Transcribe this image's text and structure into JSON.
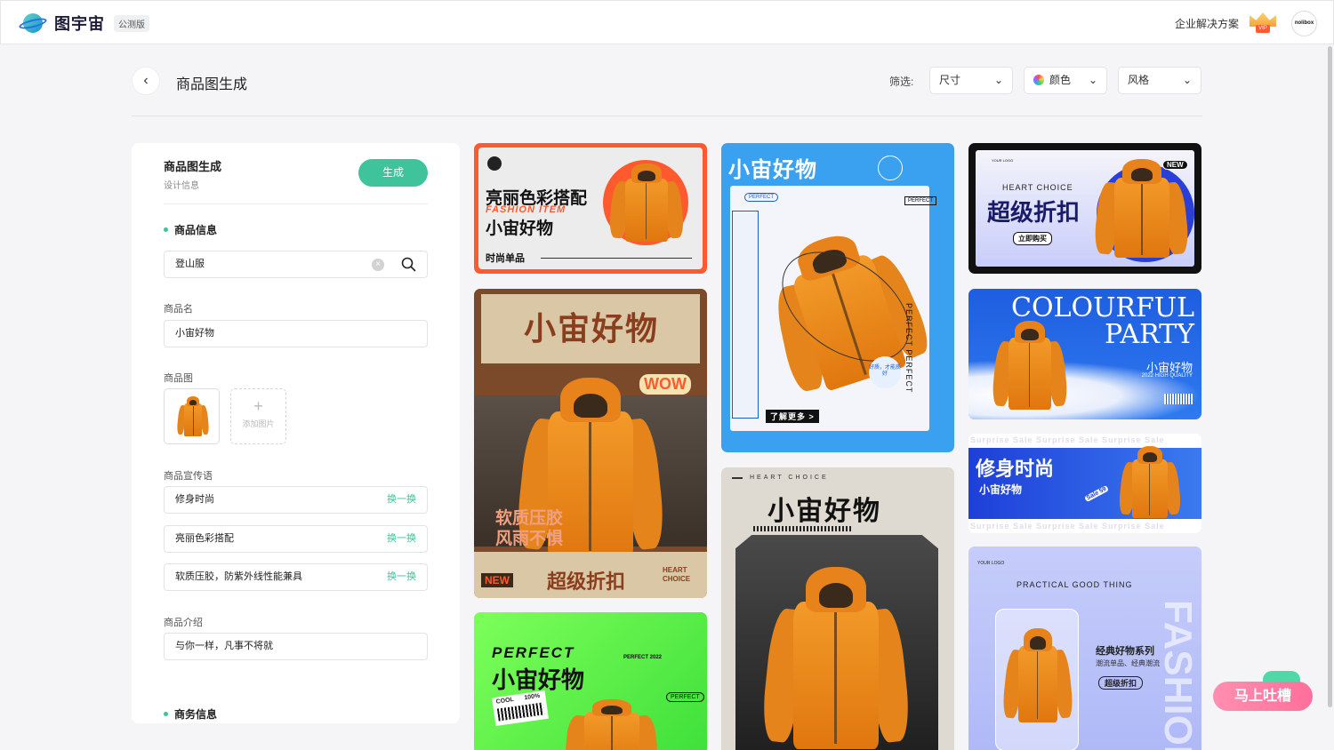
{
  "app": {
    "brand": "图宇宙",
    "badge": "公测版",
    "enterprise": "企业解决方案",
    "vip": "VIP",
    "avatar": "nolibox"
  },
  "header": {
    "title": "商品图生成",
    "filter_label": "筛选:",
    "filters": [
      "尺寸",
      "颜色",
      "风格"
    ]
  },
  "panel": {
    "title": "商品图生成",
    "subtitle": "设计信息",
    "generate": "生成",
    "section_product": "商品信息",
    "search_value": "登山服",
    "name_label": "商品名",
    "name_value": "小宙好物",
    "image_label": "商品图",
    "add_image": "添加图片",
    "slogan_label": "商品宣传语",
    "slogans": [
      "修身时尚",
      "亮丽色彩搭配",
      "软质压胶，防紫外线性能兼具"
    ],
    "swap": "换一换",
    "intro_label": "商品介绍",
    "intro_value": "与你一样，凡事不将就",
    "section_business": "商务信息"
  },
  "cards": {
    "c1": {
      "t1": "亮丽色彩搭配",
      "t2": "FASHION ITEM",
      "t3": "小宙好物",
      "t4": "时尚单品"
    },
    "c2": {
      "t1": "小宙好物",
      "t2": "WOW",
      "t3": "软质压胶",
      "t4": "风雨不惧",
      "t5": "NEW",
      "t6": "超级折扣",
      "t7": "HEART CHOICE"
    },
    "c3": {
      "t1": "PERFECT",
      "t2": "小宙好物",
      "t3": "PERFECT 2022",
      "t4": "PERFECT",
      "t5": "COOL",
      "t6": "100%"
    },
    "c4": {
      "t1": "小宙好物",
      "t2": "PERFECT",
      "t3": "PERFECT",
      "t4": "PERFECT PERFECT",
      "t5": "了解更多 >",
      "t6": "好质，才能质好"
    },
    "c5": {
      "t1": "HEART CHOICE",
      "t2": "小宙好物"
    },
    "c6": {
      "t1": "YOUR LOGO",
      "t2": "HEART CHOICE",
      "t3": "超级折扣",
      "t4": "立即购买",
      "t5": "NEW"
    },
    "c7": {
      "t1": "COLOURFUL",
      "t2": "PARTY",
      "t3": "小宙好物",
      "t4": "2022 HIGH QUALITY"
    },
    "c8": {
      "t1": "Surprise Sale Surprise Sale Surprise Sale",
      "t2": "修身时尚",
      "t3": "小宙好物",
      "t4": "Sale 59"
    },
    "c9": {
      "t1": "YOUR LOGO",
      "t2": "PRACTICAL GOOD THING",
      "t3": "经典好物系列",
      "t4": "潮流单品、经典潮流",
      "t5": "超级折扣",
      "t6": "FASHION"
    }
  },
  "feedback": "马上吐槽",
  "colors": {
    "accent": "#3ec39a",
    "orange": "#ff5a2e",
    "pink": "#ff6f9c"
  }
}
